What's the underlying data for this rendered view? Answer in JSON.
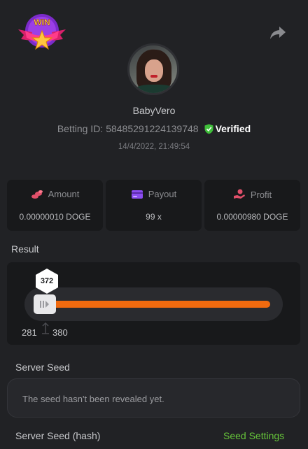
{
  "header": {
    "logo_text": "WIN",
    "username": "BabyVero",
    "betting_id_label": "Betting ID:",
    "betting_id_value": "58485291224139748",
    "verified_label": "Verified",
    "timestamp": "14/4/2022, 21:49:54"
  },
  "stats": [
    {
      "label": "Amount",
      "value": "0.00000010 DOGE",
      "icon": "coins-icon",
      "color": "#e0506a"
    },
    {
      "label": "Payout",
      "value": "99 x",
      "icon": "card-icon",
      "color": "#8b4df0"
    },
    {
      "label": "Profit",
      "value": "0.00000980 DOGE",
      "icon": "hand-coin-icon",
      "color": "#e0506a"
    }
  ],
  "result": {
    "label": "Result",
    "roll_value": "372",
    "range_min": "281",
    "range_max": "380",
    "fill_color": "#f06a0f"
  },
  "server_seed": {
    "label": "Server Seed",
    "message": "The seed hasn't been revealed yet."
  },
  "server_seed_hash": {
    "label": "Server Seed (hash)",
    "settings_link": "Seed Settings"
  },
  "colors": {
    "background": "#212225",
    "panel": "#18191b",
    "accent_green": "#66c43a",
    "accent_orange": "#f06a0f"
  }
}
